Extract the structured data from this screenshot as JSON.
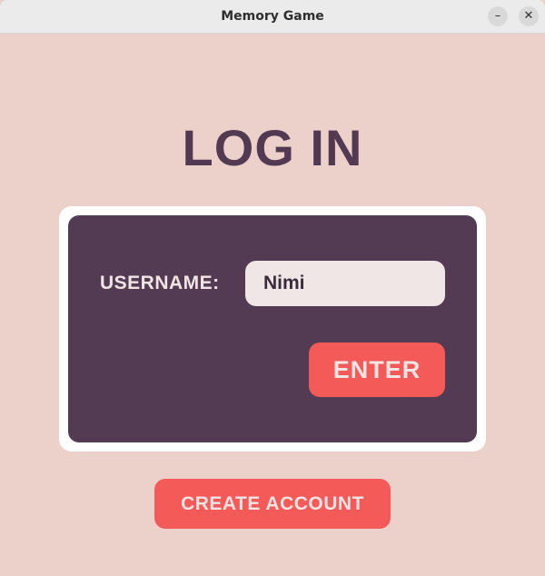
{
  "window": {
    "title": "Memory Game",
    "minimize_glyph": "–",
    "close_glyph": "✕"
  },
  "login": {
    "heading": "LOG IN",
    "username_label": "USERNAME:",
    "username_value": "Nimi",
    "enter_label": "ENTER",
    "create_account_label": "CREATE ACCOUNT"
  },
  "colors": {
    "background": "#ecd1cb",
    "panel": "#533b53",
    "accent": "#f45a58",
    "heading": "#533a53",
    "input_bg": "#f1e6e6"
  },
  "icons": {
    "minimize": "minimize-icon",
    "close": "close-icon"
  }
}
